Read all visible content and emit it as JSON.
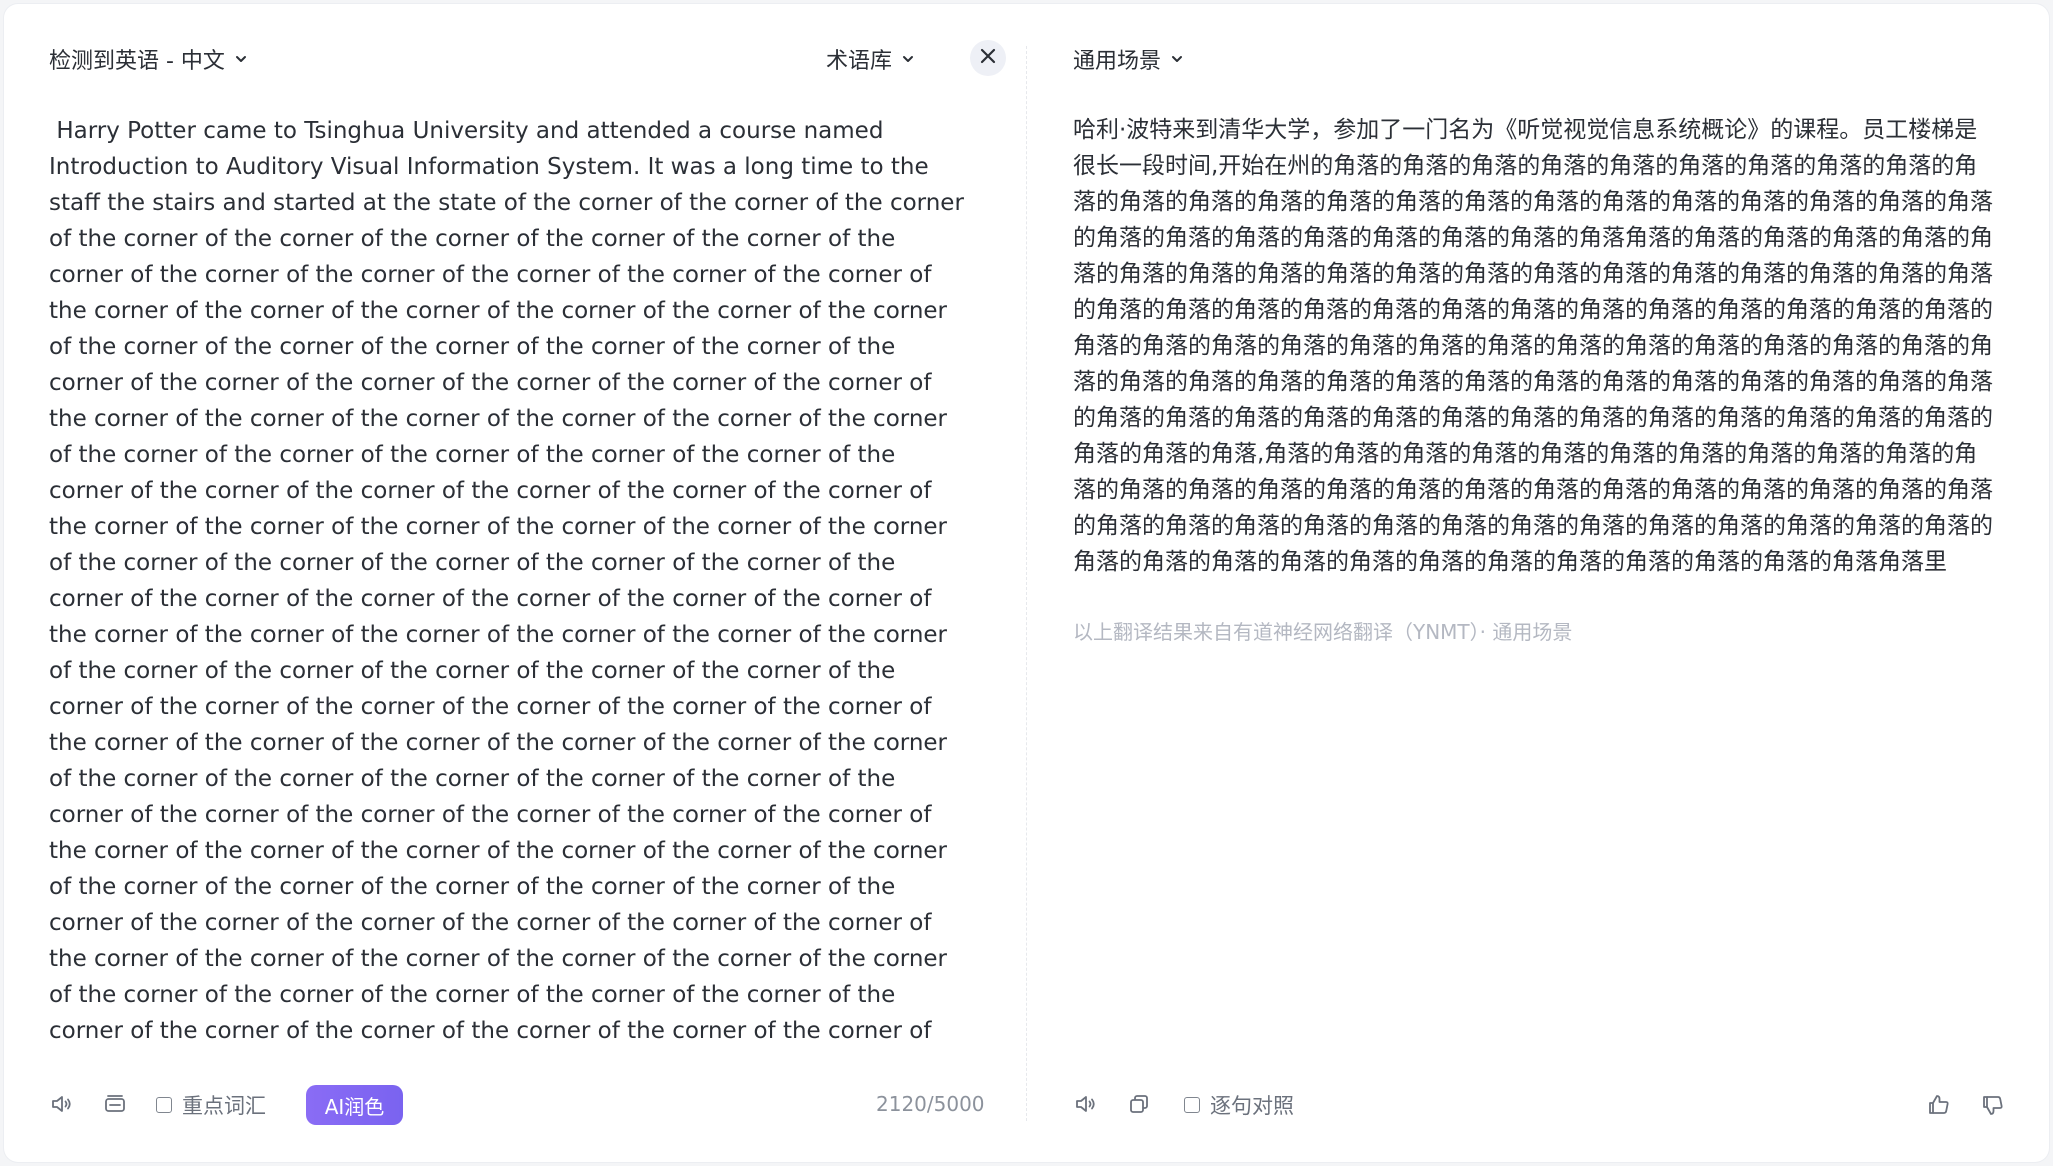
{
  "source_panel": {
    "language_select": "检测到英语 - 中文",
    "glossary_label": "术语库",
    "text": " Harry Potter came to Tsinghua University and attended a course named Introduction to Auditory Visual Information System. It was a long time to the staff the stairs and started at the state of the corner of the corner of the corner of the corner of the corner of the corner of the corner of the corner of the corner of the corner of the corner of the corner of the corner of the corner of the corner of the corner of the corner of the corner of the corner of the corner of the corner of the corner of the corner of the corner of the corner of the corner of the corner of the corner of the corner of the corner of the corner of the corner of the corner of the corner of the corner of the corner of the corner of the corner of the corner of the corner of the corner of the corner of the corner of the corner of the corner of the corner of the corner of the corner of the corner of the corner of the corner of the corner of the corner of the corner of the corner of the corner of the corner of the corner of the corner of the corner of the corner of the corner of the corner of the corner of the corner of the corner of the corner of the corner of the corner of the corner of the corner of the corner of the corner of the corner of the corner of the corner of the corner of the corner of the corner of the corner of the corner of the corner of the corner of the corner of the corner of the corner of the corner of the corner of the corner of the corner of the corner of the corner of the corner of the corner of the corner of the corner of the corner of the corner of the corner of the corner of the corner of the corner of the corner of the corner of the corner of the corner of the corner of the corner of the corner of the corner of the corner of the corner of the corner of the corner of the corner of the corner of the corner of the corner of the corner of the corner of the corner of the corner of the corner of the corner of the corner of the corner of the corner of the corner of the corner of the corner of the corner of the corner of the corner of the corner of the corner of the corner of the corner of the corner of the corner of the corner of the corner of the corner of the corner of the corner of the corner of the corner of the corner of the corner of the corner of the corner of the corner of the corner of the corner of the corner of the corner of the corner of the corner of the corner of the corner of the corner of the corner of the corner of the corner of the corner of the corner of the corner of the corner of the corner of the corner of the corner of the corner of the corner of the corner of the corner of the corner of the corner of the corner of the corner of the corner of the corner of the corner of the corner of the corner of the corner of the corner of the corner of the corner of the corner of the corner of the corner of the corner of the corner of the corner of the corner of the corner of the corner of the corner of the corner of the corner of the corner of the corner of the corner of the corner of the corner of the corner of the corner of the corner of the corner of the corner of the corner of the corner of the corner of the corner of the corner of the corner of the corner of the corner of the corner of the corner of the corner",
    "keywords_label": "重点词汇",
    "ai_polish_label": "AI润色",
    "char_count": "2120/5000"
  },
  "target_panel": {
    "scene_select": "通用场景",
    "text": "哈利·波特来到清华大学，参加了一门名为《听觉视觉信息系统概论》的课程。员工楼梯是很长一段时间,开始在州的角落的角落的角落的角落的角落的角落的角落的角落的角落的角落的角落的角落的角落的角落的角落的角落的角落的角落的角落的角落的角落的角落的角落的角落的角落的角落的角落的角落的角落的角落的角落角落的角落的角落的角落的角落的角落的角落的角落的角落的角落的角落的角落的角落的角落的角落的角落的角落的角落的角落的角落的角落的角落的角落的角落的角落的角落的角落的角落的角落的角落的角落的角落的角落的角落的角落的角落的角落的角落的角落的角落的角落的角落的角落的角落的角落的角落的角落的角落的角落的角落的角落的角落的角落的角落的角落的角落的角落的角落的角落的角落的角落的角落的角落的角落的角落的角落的角落的角落的角落的角落的角落的角落的角落的角落的角落,角落的角落的角落的角落的角落的角落的角落的角落的角落的角落的角落的角落的角落的角落的角落的角落的角落的角落的角落的角落的角落的角落的角落的角落的角落的角落的角落的角落的角落的角落的角落的角落的角落的角落的角落的角落的角落的角落的角落的角落的角落的角落的角落的角落的角落的角落的角落的角落的角落角落里",
    "source_note": "以上翻译结果来自有道神经网络翻译（YNMT）· 通用场景",
    "sentence_compare_label": "逐句对照"
  },
  "icons": {
    "speaker": "speaker-icon",
    "layout": "layout-icon",
    "copy": "copy-icon",
    "close": "close-icon",
    "chevron": "chevron-down-icon",
    "thumbs_up": "thumbs-up-icon",
    "thumbs_down": "thumbs-down-icon"
  },
  "colors": {
    "accent": "#7a63f0",
    "muted_text": "#b4b8c2",
    "text": "#2b2f36"
  }
}
